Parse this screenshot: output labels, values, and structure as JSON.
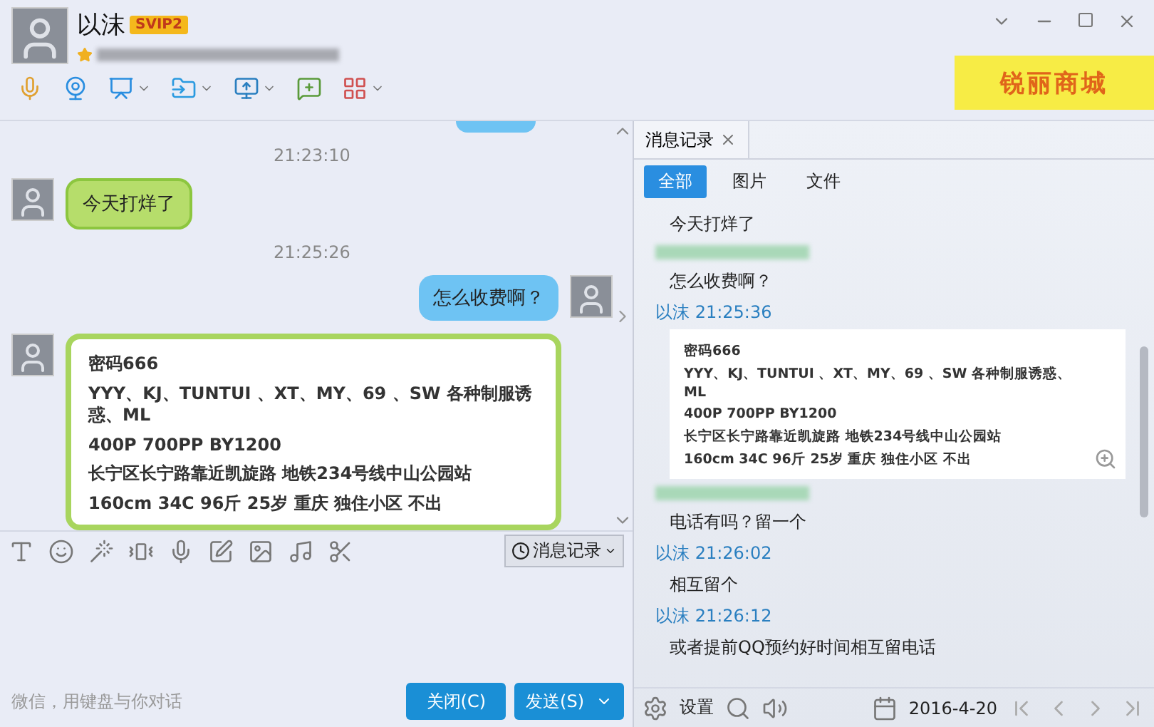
{
  "header": {
    "name": "以沫",
    "badge": "SVIP2",
    "banner": "锐丽商城"
  },
  "chat": {
    "messages": [
      {
        "kind": "time",
        "text": "21:23:10"
      },
      {
        "kind": "incoming",
        "text": "今天打烊了"
      },
      {
        "kind": "time",
        "text": "21:25:26"
      },
      {
        "kind": "outgoing",
        "text": "怎么收费啊？"
      },
      {
        "kind": "card",
        "lines": [
          "密码666",
          "YYY、KJ、TUNTUI 、XT、MY、69 、SW 各种制服诱惑、ML",
          "400P  700PP  BY1200",
          "长宁区长宁路靠近凯旋路 地铁234号线中山公园站",
          "160cm 34C  96斤 25岁 重庆 独住小区 不出"
        ]
      }
    ]
  },
  "composer": {
    "history_button": "消息记录",
    "hint": "微信，用键盘与你对话",
    "buttons": [
      {
        "kind": "close",
        "label": "关闭(C)"
      },
      {
        "kind": "send",
        "label": "发送(S)"
      }
    ]
  },
  "history": {
    "tab": "消息记录",
    "filters": [
      {
        "label": "全部",
        "selected": true
      },
      {
        "label": "图片",
        "selected": false
      },
      {
        "label": "文件",
        "selected": false
      }
    ],
    "entries": [
      {
        "kind": "text",
        "text": "今天打烊了"
      },
      {
        "kind": "blurred"
      },
      {
        "kind": "text",
        "text": "怎么收费啊？"
      },
      {
        "kind": "sender",
        "text": "以沫 21:25:36"
      },
      {
        "kind": "card",
        "lines": [
          "密码666",
          "YYY、KJ、TUNTUI 、XT、MY、69 、SW 各种制服诱惑、ML",
          "400P  700PP  BY1200",
          "长宁区长宁路靠近凯旋路 地铁234号线中山公园站",
          "160cm 34C  96斤 25岁 重庆 独住小区 不出"
        ]
      },
      {
        "kind": "blurred"
      },
      {
        "kind": "text",
        "text": "电话有吗？留一个"
      },
      {
        "kind": "sender",
        "text": "以沫 21:26:02"
      },
      {
        "kind": "text",
        "text": "相互留个"
      },
      {
        "kind": "sender",
        "text": "以沫 21:26:12"
      },
      {
        "kind": "text",
        "text": "或者提前QQ预约好时间相互留电话"
      }
    ],
    "settings": "设置",
    "date": "2016-4-20"
  }
}
